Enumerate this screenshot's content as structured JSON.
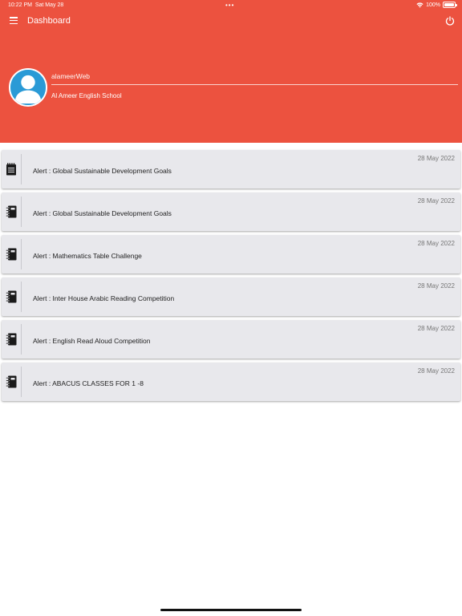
{
  "status_bar": {
    "time": "10:22 PM",
    "date": "Sat May 28",
    "battery": "100%"
  },
  "header": {
    "title": "Dashboard",
    "username": "alameerWeb",
    "school": "Al Ameer English School"
  },
  "colors": {
    "accent": "#ec523f",
    "avatar_bg": "#2a9ad6",
    "card_bg": "#e8e8ec"
  },
  "alerts": [
    {
      "date": "28 May 2022",
      "text": "Alert : Global Sustainable Development Goals",
      "icon": "notepad-icon"
    },
    {
      "date": "28 May 2022",
      "text": "Alert : Global Sustainable Development Goals",
      "icon": "notebook-icon"
    },
    {
      "date": "28 May 2022",
      "text": "Alert : Mathematics Table Challenge",
      "icon": "notebook-icon"
    },
    {
      "date": "28 May 2022",
      "text": "Alert : Inter House Arabic Reading Competition",
      "icon": "notebook-icon"
    },
    {
      "date": "28 May 2022",
      "text": "Alert : English Read Aloud Competition",
      "icon": "notebook-icon"
    },
    {
      "date": "28 May 2022",
      "text": "Alert : ABACUS CLASSES FOR 1 -8",
      "icon": "notebook-icon"
    }
  ]
}
